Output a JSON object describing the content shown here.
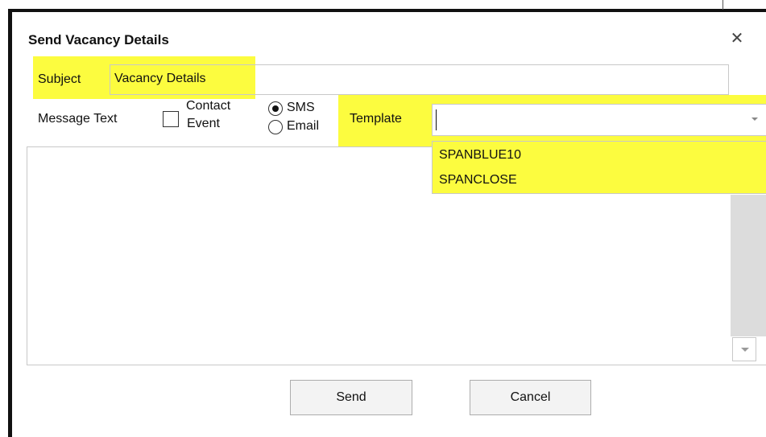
{
  "dialog": {
    "title": "Send Vacancy Details",
    "close_symbol": "✕"
  },
  "subject": {
    "label": "Subject",
    "value": "Vacancy Details"
  },
  "message": {
    "label": "Message Text",
    "contact_event_checkbox": {
      "label_line1": "Contact",
      "label_line2": "Event",
      "checked": false
    },
    "channel_options": [
      {
        "label": "SMS",
        "selected": true
      },
      {
        "label": "Email",
        "selected": false
      }
    ],
    "body_value": ""
  },
  "template": {
    "label": "Template",
    "value": "",
    "options": [
      "SPANBLUE10",
      "SPANCLOSE"
    ]
  },
  "buttons": {
    "send": "Send",
    "cancel": "Cancel"
  },
  "colors": {
    "highlight": "#fcfc3f",
    "frame": "#111111"
  },
  "icons": {
    "close": "close-icon",
    "dropdown": "chevron-down-icon",
    "scroll_down": "scroll-down-arrow-icon"
  }
}
